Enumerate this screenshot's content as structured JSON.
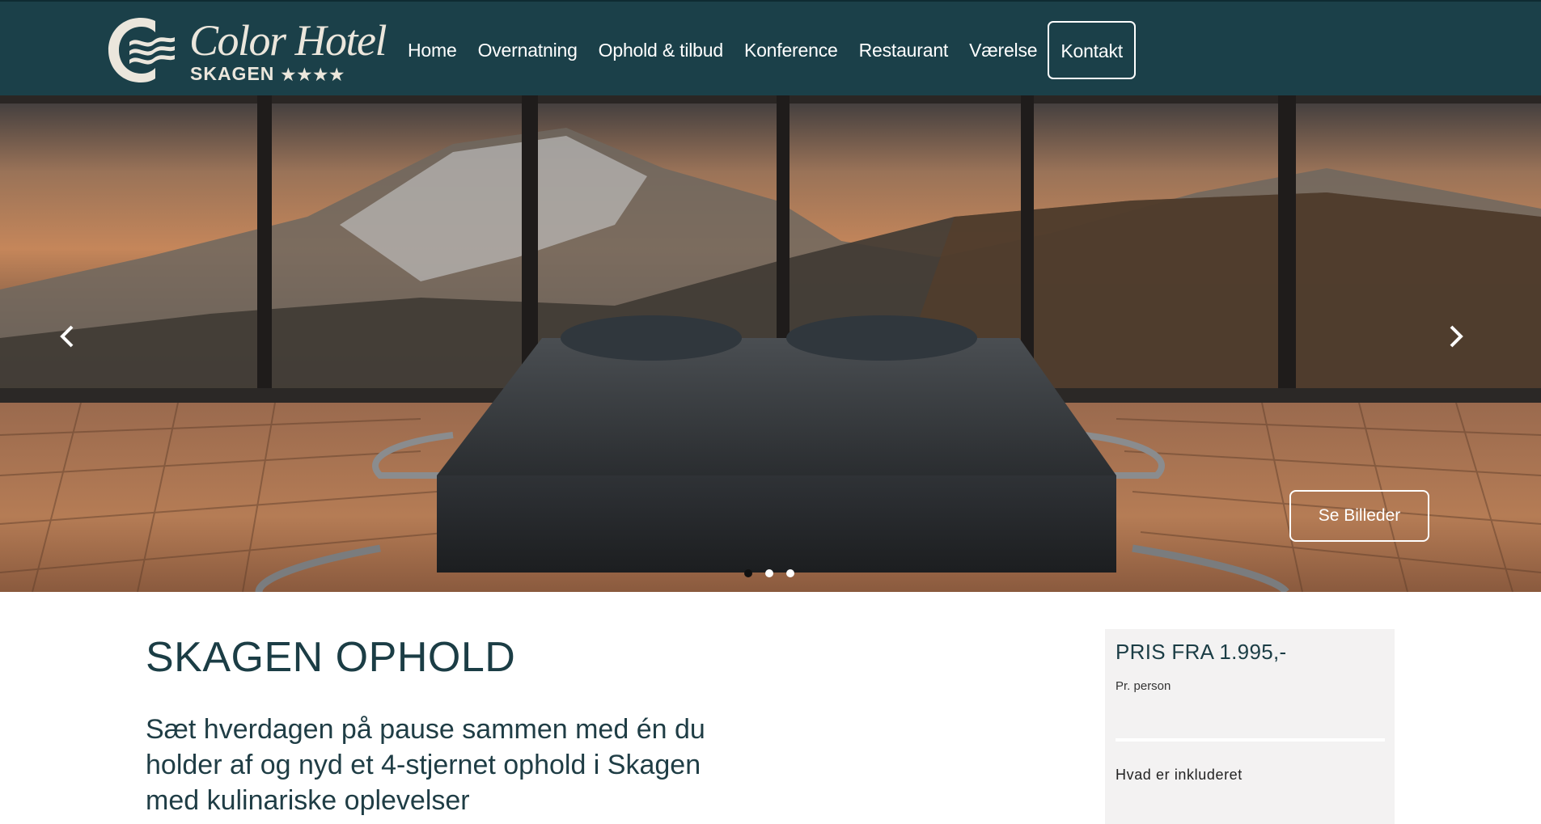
{
  "brand": {
    "name": "Color Hotel",
    "location": "SKAGEN",
    "stars": "★★★★",
    "colors": {
      "header_bg": "#1b4049",
      "logo": "#ebe6dc",
      "text_dark": "#1b3d45"
    }
  },
  "nav": {
    "items": [
      {
        "label": "Home"
      },
      {
        "label": "Overnatning"
      },
      {
        "label": "Ophold & tilbud"
      },
      {
        "label": "Konference"
      },
      {
        "label": "Restaurant"
      },
      {
        "label": "Værelse"
      }
    ],
    "contact_label": "Kontakt"
  },
  "hero": {
    "gallery_button": "Se Billeder",
    "prev_icon": "chevron-left-icon",
    "next_icon": "chevron-right-icon",
    "slide_count": 3,
    "active_slide": 1
  },
  "content": {
    "title": "SKAGEN OPHOLD",
    "intro": "Sæt hverdagen på pause sammen med én du holder af og nyd et 4-stjernet ophold i Skagen med kulinariske oplevelser"
  },
  "price_box": {
    "heading": "PRIS FRA 1.995,-",
    "unit": "Pr. person",
    "included_label": "Hvad er inkluderet"
  }
}
